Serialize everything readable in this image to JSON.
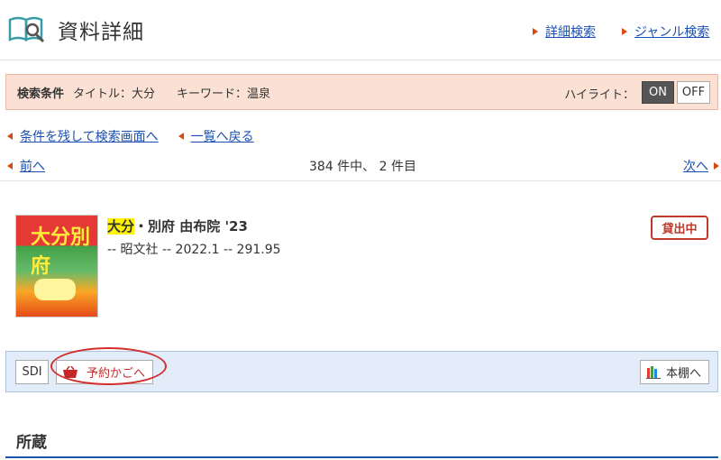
{
  "header": {
    "title": "資料詳細",
    "links": [
      "詳細検索",
      "ジャンル検索"
    ]
  },
  "search_conditions": {
    "label": "検索条件",
    "title_cond": "タイトル：大分",
    "keyword_cond": "キーワード：温泉",
    "highlight_label": "ハイライト：",
    "on_label": "ON",
    "off_label": "OFF"
  },
  "navigation": {
    "back_to_search": "条件を残して検索画面へ",
    "back_to_list": "一覧へ戻る",
    "prev": "前へ",
    "next": "次へ",
    "count_text": "384 件中、 2 件目"
  },
  "book": {
    "title_highlight": "大分",
    "title_rest": "・別府 由布院 '23",
    "meta": "-- 昭文社 -- 2022.1 -- 291.95",
    "status": "貸出中",
    "cover_text": "大分別府"
  },
  "actions": {
    "sdi": "SDI",
    "cart": "予約かごへ",
    "shelf": "本棚へ"
  },
  "holdings": {
    "title": "所蔵"
  },
  "colors": {
    "accent": "#d9480f",
    "link": "#1a4fb0",
    "condition_bg": "#fbe0d4",
    "action_bg": "#e3edf9",
    "status_red": "#c0392b"
  },
  "icons": [
    "book-search-icon",
    "basket-icon",
    "bookshelf-icon"
  ]
}
